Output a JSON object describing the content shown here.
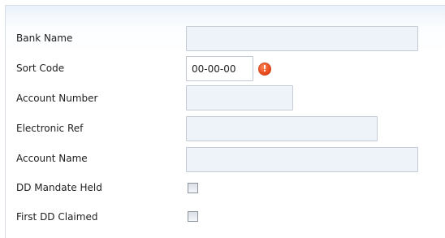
{
  "form": {
    "bank_name": {
      "label": "Bank Name",
      "value": ""
    },
    "sort_code": {
      "label": "Sort Code",
      "value": "00-00-00",
      "has_error": true
    },
    "account_number": {
      "label": "Account Number",
      "value": ""
    },
    "electronic_ref": {
      "label": "Electronic Ref",
      "value": ""
    },
    "account_name": {
      "label": "Account Name",
      "value": ""
    },
    "dd_mandate_held": {
      "label": "DD Mandate Held",
      "checked": false
    },
    "first_dd_claimed": {
      "label": "First DD Claimed",
      "checked": false
    }
  },
  "icons": {
    "error": "!"
  },
  "colors": {
    "field_background": "#eef3fa",
    "error": "#ea4a1c"
  }
}
